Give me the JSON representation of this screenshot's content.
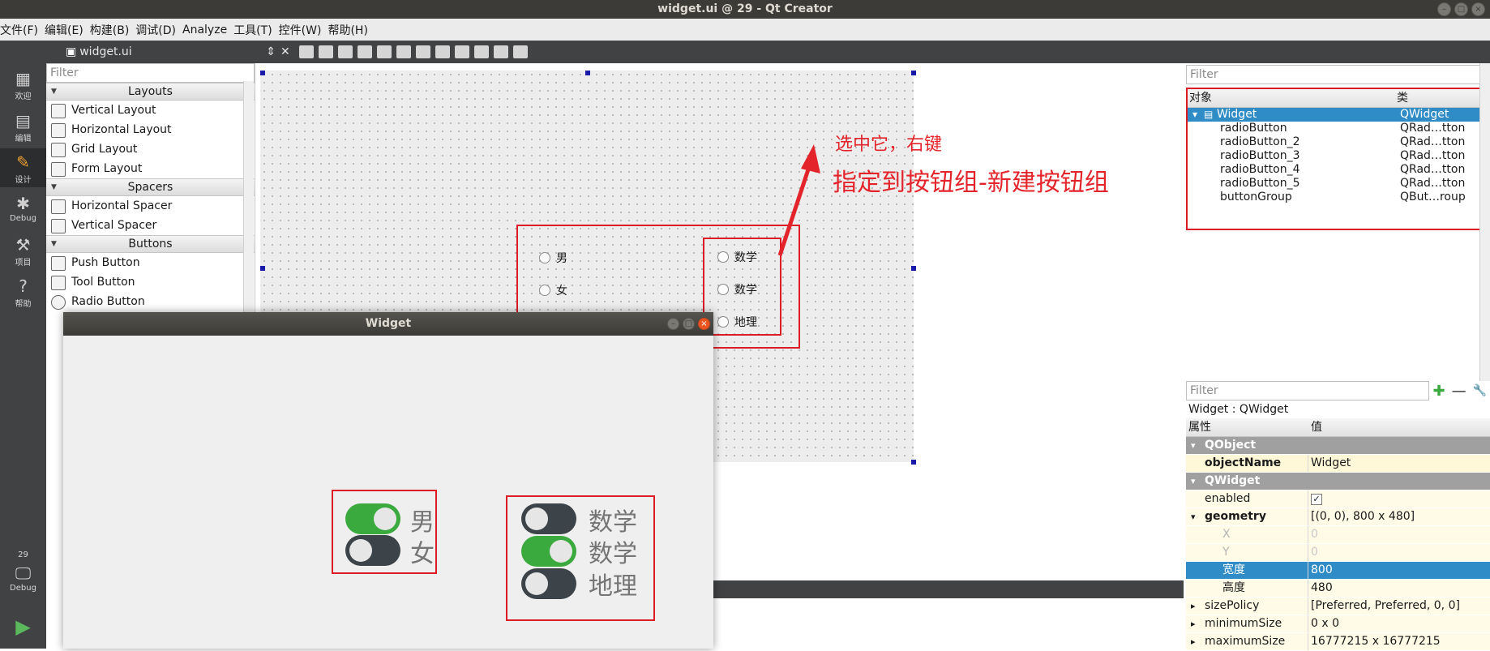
{
  "window": {
    "title": "widget.ui @ 29 - Qt Creator"
  },
  "menu": [
    {
      "label": "文件(F)"
    },
    {
      "label": "编辑(E)"
    },
    {
      "label": "构建(B)"
    },
    {
      "label": "调试(D)"
    },
    {
      "label": "Analyze"
    },
    {
      "label": "工具(T)"
    },
    {
      "label": "控件(W)"
    },
    {
      "label": "帮助(H)"
    }
  ],
  "modes": [
    {
      "label": "欢迎",
      "icon": "grid-icon"
    },
    {
      "label": "编辑",
      "icon": "document-icon"
    },
    {
      "label": "设计",
      "icon": "pencil-icon"
    },
    {
      "label": "Debug",
      "icon": "bug-icon"
    },
    {
      "label": "项目",
      "icon": "wrench-icon"
    },
    {
      "label": "帮助",
      "icon": "help-icon"
    }
  ],
  "kit": {
    "number": "29",
    "label": "Debug"
  },
  "toolbar": {
    "file": "widget.ui"
  },
  "widget_box": {
    "filter_placeholder": "Filter",
    "categories": [
      {
        "name": "Layouts",
        "items": [
          "Vertical Layout",
          "Horizontal Layout",
          "Grid Layout",
          "Form Layout"
        ]
      },
      {
        "name": "Spacers",
        "items": [
          "Horizontal Spacer",
          "Vertical Spacer"
        ]
      },
      {
        "name": "Buttons",
        "items": [
          "Push Button",
          "Tool Button",
          "Radio Button"
        ]
      }
    ]
  },
  "form": {
    "radios_left": [
      "男",
      "女"
    ],
    "radios_right": [
      "数学",
      "数学",
      "地理"
    ]
  },
  "annotation": {
    "line1": "选中它，右键",
    "line2": "指定到按钮组-新建按钮组",
    "color": "#e3242b"
  },
  "preview": {
    "title": "Widget",
    "group1": [
      {
        "label": "男",
        "on": true
      },
      {
        "label": "女",
        "on": false
      }
    ],
    "group2": [
      {
        "label": "数学",
        "on": false
      },
      {
        "label": "数学",
        "on": true
      },
      {
        "label": "地理",
        "on": false
      }
    ],
    "on_color": "#3aa93e",
    "off_color": "#3c4449"
  },
  "object_inspector": {
    "filter_placeholder": "Filter",
    "col_object": "对象",
    "col_class": "类",
    "rows": [
      {
        "name": "Widget",
        "class": "QWidget",
        "selected": true
      },
      {
        "name": "radioButton",
        "class": "QRad…tton"
      },
      {
        "name": "radioButton_2",
        "class": "QRad…tton"
      },
      {
        "name": "radioButton_3",
        "class": "QRad…tton"
      },
      {
        "name": "radioButton_4",
        "class": "QRad…tton"
      },
      {
        "name": "radioButton_5",
        "class": "QRad…tton"
      },
      {
        "name": "buttonGroup",
        "class": "QBut…roup"
      }
    ]
  },
  "property_editor": {
    "filter_placeholder": "Filter",
    "caption": "Widget : QWidget",
    "col_prop": "属性",
    "col_value": "值",
    "rows": [
      {
        "name": "QObject",
        "value": "",
        "kind": "cat"
      },
      {
        "name": "objectName",
        "value": "Widget",
        "kind": "bold"
      },
      {
        "name": "QWidget",
        "value": "",
        "kind": "cat"
      },
      {
        "name": "enabled",
        "value": "✓",
        "kind": "plain"
      },
      {
        "name": "geometry",
        "value": "[(0, 0), 800 x 480]",
        "kind": "bold"
      },
      {
        "name": "X",
        "value": "0",
        "kind": "dim"
      },
      {
        "name": "Y",
        "value": "0",
        "kind": "dim"
      },
      {
        "name": "宽度",
        "value": "800",
        "kind": "sel"
      },
      {
        "name": "高度",
        "value": "480",
        "kind": "plain"
      },
      {
        "name": "sizePolicy",
        "value": "[Preferred, Preferred, 0, 0]",
        "kind": "plain"
      },
      {
        "name": "minimumSize",
        "value": "0 x 0",
        "kind": "plain"
      },
      {
        "name": "maximumSize",
        "value": "16777215 x 16777215",
        "kind": "plain"
      }
    ]
  }
}
